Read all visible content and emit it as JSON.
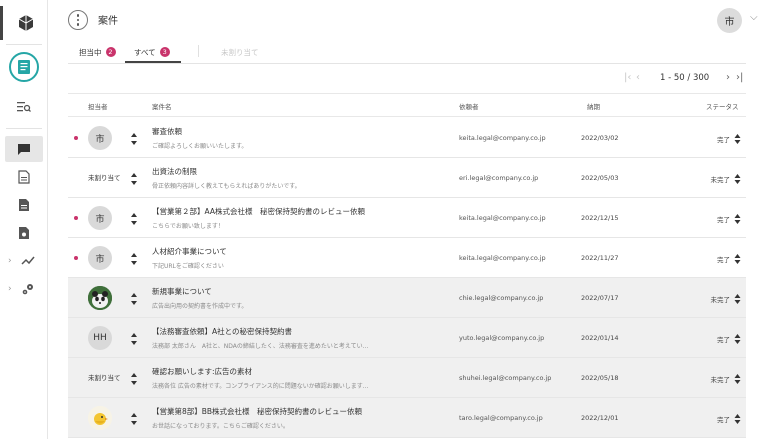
{
  "header": {
    "title": "案件",
    "user_initial": "市"
  },
  "tabs": [
    {
      "label": "担当中",
      "count": "2"
    },
    {
      "label": "すべて",
      "count": "3"
    },
    {
      "label": "未割り当て"
    }
  ],
  "pagination": {
    "range": "1 - 50 / 300"
  },
  "columns": {
    "assignee": "担当者",
    "case_name": "案件名",
    "requester": "依頼者",
    "due": "納期",
    "status": "ステータス"
  },
  "rows": [
    {
      "assignee": "市",
      "title": "審査依頼",
      "sub": "ご確認よろしくお願いいたします。",
      "email": "keita.legal@company.co.jp",
      "date": "2022/03/02",
      "status": "完了"
    },
    {
      "assignee": "未割り当て",
      "title": "出資法の制限",
      "sub": "骨正依頼内容詳しく教えてもらえればありがたいです。",
      "email": "eri.legal@company.co.jp",
      "date": "2022/05/03",
      "status": "未完了"
    },
    {
      "assignee": "市",
      "title": "【営業第２部】AA株式会社様　秘密保持契約書のレビュー依頼",
      "sub": "こちらでお願い致します！",
      "email": "keita.legal@company.co.jp",
      "date": "2022/12/15",
      "status": "完了"
    },
    {
      "assignee": "市",
      "title": "人材紹介事業について",
      "sub": "下記URLをご確認ください",
      "email": "keita.legal@company.co.jp",
      "date": "2022/11/27",
      "status": "完了"
    },
    {
      "assignee": "",
      "title": "新規事業について",
      "sub": "広告出向用の契約書を作成中です。",
      "email": "chie.legal@company.co.jp",
      "date": "2022/07/17",
      "status": "未完了"
    },
    {
      "assignee": "HH",
      "title": "【法務審査依頼】A社との秘密保持契約書",
      "sub": "法務部 太郎さん　A社と、NDAの締結したく、法務審査を進めたいと考えてい...",
      "email": "yuto.legal@company.co.jp",
      "date": "2022/01/14",
      "status": "完了"
    },
    {
      "assignee": "未割り当て",
      "title": "確認お願いします:広告の素材",
      "sub": "法務各位 広告の素材です。コンプライアンス的に問題ないか確認お願いします...",
      "email": "shuhei.legal@company.co.jp",
      "date": "2022/05/18",
      "status": "未完了"
    },
    {
      "assignee": "",
      "title": "【営業第8部】BB株式会社様　秘密保持契約書のレビュー依頼",
      "sub": "お世話になっております。こちらご確認ください。",
      "email": "taro.legal@company.co.jp",
      "date": "2022/12/01",
      "status": "完了"
    }
  ],
  "colors": {
    "accent_pink": "#c9336b",
    "accent_teal": "#25a6a6"
  }
}
